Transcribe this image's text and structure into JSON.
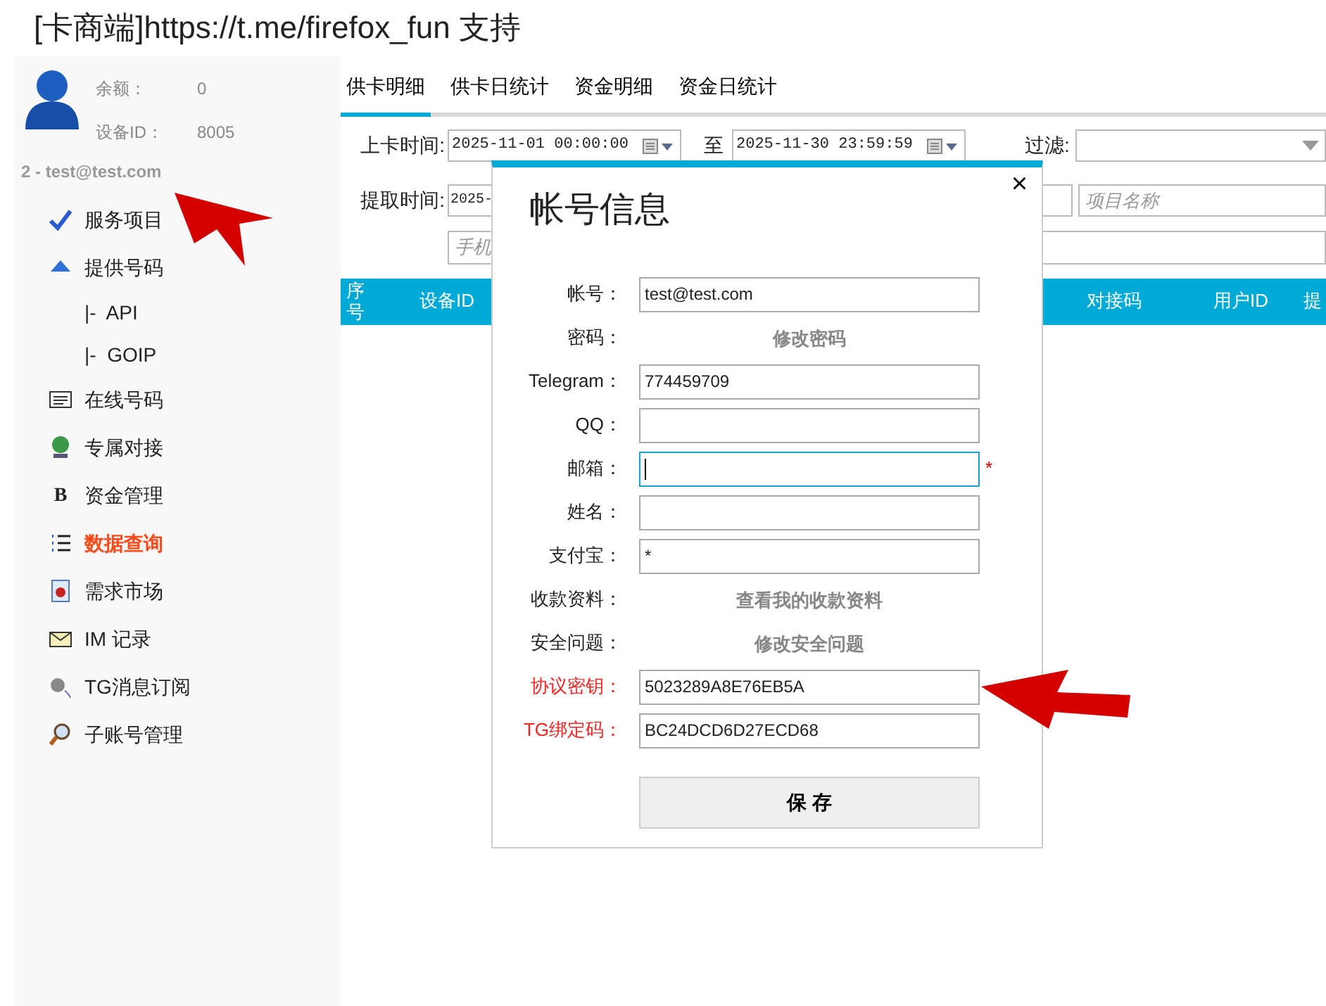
{
  "page_title": "[卡商端]https://t.me/firefox_fun 支持",
  "sidebar": {
    "balance_label": "余额：",
    "balance": "0",
    "device_label": "设备ID：",
    "device_id": "8005",
    "account": "2 - test@test.com",
    "items": [
      {
        "label": "服务项目",
        "selected": false
      },
      {
        "label": "提供号码",
        "selected": false,
        "children": [
          {
            "label": "|-  API",
            "selected": false
          },
          {
            "label": "|-  GOIP",
            "selected": false
          }
        ]
      },
      {
        "label": "在线号码",
        "selected": false
      },
      {
        "label": "专属对接",
        "selected": false
      },
      {
        "label": "资金管理",
        "glyph": "B",
        "selected": false
      },
      {
        "label": "数据查询",
        "selected": true
      },
      {
        "label": "需求市场",
        "selected": false
      },
      {
        "label": "IM 记录",
        "selected": false
      },
      {
        "label": "TG消息订阅",
        "selected": false
      },
      {
        "label": "子账号管理",
        "selected": false
      }
    ]
  },
  "tabs": [
    {
      "label": "供卡明细",
      "selected": true
    },
    {
      "label": "供卡日统计",
      "selected": false
    },
    {
      "label": "资金明细",
      "selected": false
    },
    {
      "label": "资金日统计",
      "selected": false
    }
  ],
  "filters": {
    "upload_label": "上卡时间:",
    "upload_from": "2025-11-01 00:00:00",
    "to_label": "至",
    "upload_to": "2025-11-30 23:59:59",
    "filter_label": "过滤:",
    "fetch_label": "提取时间:",
    "fetch_from": "2025-",
    "project_placeholder": "项目名称",
    "phone_placeholder": "手机"
  },
  "table": {
    "columns": [
      "序号",
      "设备ID",
      "对接码",
      "用户ID",
      "提"
    ]
  },
  "dialog": {
    "title": "帐号信息",
    "close": "×",
    "rows": [
      {
        "kind": "input",
        "label": "帐号：",
        "value": "test@test.com",
        "focused": false,
        "highlighted": false
      },
      {
        "kind": "link",
        "label": "密码：",
        "value": "修改密码",
        "highlighted": false
      },
      {
        "kind": "input",
        "label": "Telegram：",
        "value": "774459709",
        "focused": false,
        "highlighted": false
      },
      {
        "kind": "input",
        "label": "QQ：",
        "focused": false,
        "highlighted": false
      },
      {
        "kind": "input",
        "label": "邮箱：",
        "focused": true,
        "required_mark": "*",
        "highlighted": false
      },
      {
        "kind": "input",
        "label": "姓名：",
        "focused": false,
        "highlighted": false
      },
      {
        "kind": "input",
        "label": "支付宝：",
        "value": "*",
        "focused": false,
        "highlighted": false
      },
      {
        "kind": "link",
        "label": "收款资料：",
        "value": "查看我的收款资料",
        "highlighted": false
      },
      {
        "kind": "link",
        "label": "安全问题：",
        "value": "修改安全问题",
        "highlighted": false
      },
      {
        "kind": "input",
        "label": "协议密钥：",
        "value": "5023289A8E76EB5A",
        "focused": false,
        "highlighted": true
      },
      {
        "kind": "input",
        "label": "TG绑定码：",
        "value": "BC24DCD6D27ECD68",
        "focused": false,
        "highlighted": true
      }
    ],
    "save": "保 存"
  }
}
